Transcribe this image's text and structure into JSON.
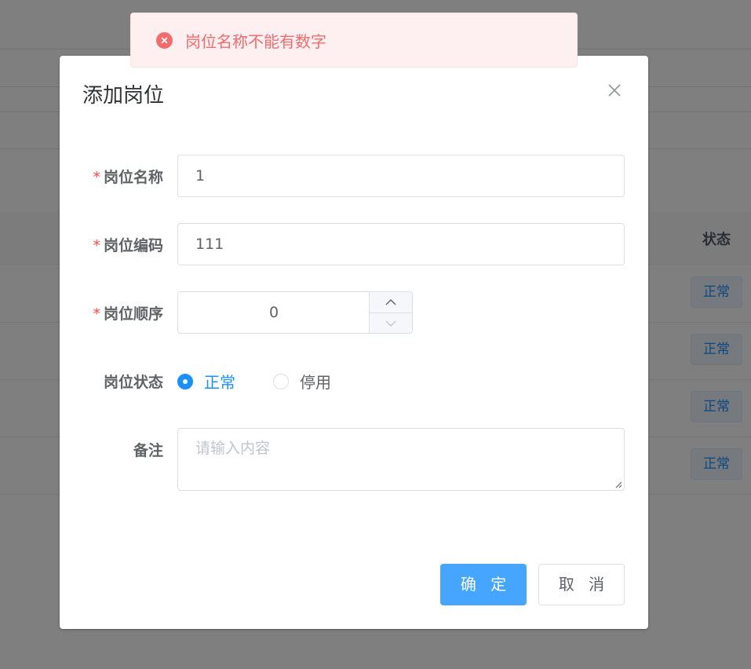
{
  "background": {
    "status_column_header": "状态",
    "rows": [
      {
        "status": "正常"
      },
      {
        "status": "正常"
      },
      {
        "status": "正常"
      },
      {
        "status": "正常"
      }
    ]
  },
  "toast": {
    "type": "error",
    "icon": "error-circle-icon",
    "message": "岗位名称不能有数字"
  },
  "dialog": {
    "title": "添加岗位",
    "fields": {
      "post_name": {
        "label": "岗位名称",
        "required": true,
        "value": "1"
      },
      "post_code": {
        "label": "岗位编码",
        "required": true,
        "value": "111"
      },
      "post_sort": {
        "label": "岗位顺序",
        "required": true,
        "value": "0"
      },
      "post_status": {
        "label": "岗位状态",
        "options": [
          "正常",
          "停用"
        ],
        "selected": "正常"
      },
      "remark": {
        "label": "备注",
        "value": "",
        "placeholder": "请输入内容"
      }
    },
    "buttons": {
      "confirm": "确 定",
      "cancel": "取 消"
    }
  },
  "colors": {
    "primary": "#1890ff",
    "error": "#f56c6c",
    "required_star": "#ff4949"
  }
}
